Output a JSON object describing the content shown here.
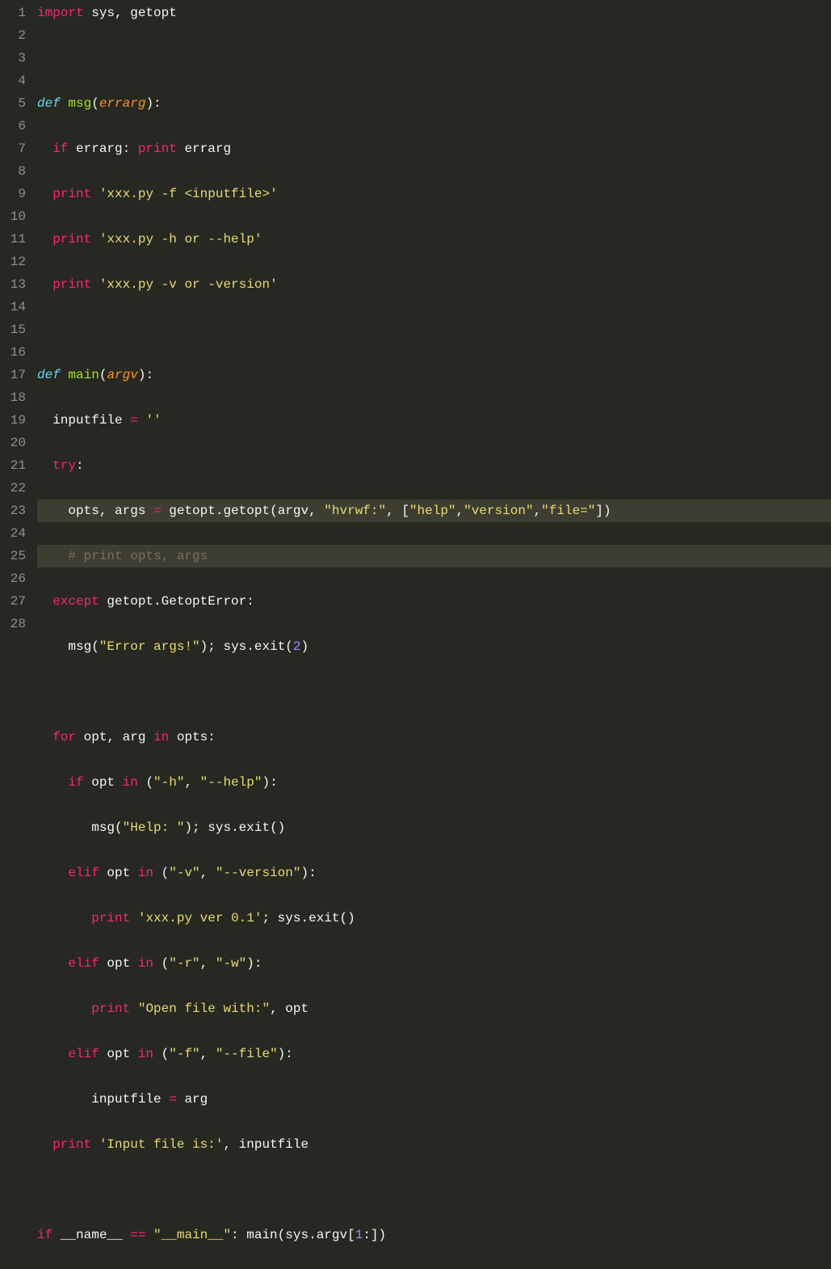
{
  "lines": [
    {
      "num": "1",
      "hl": false,
      "tokens": [
        {
          "cls": "kw-import",
          "t": "import"
        },
        {
          "cls": "ident",
          "t": " sys"
        },
        {
          "cls": "punct",
          "t": ", "
        },
        {
          "cls": "ident",
          "t": "getopt"
        }
      ]
    },
    {
      "num": "2",
      "hl": false,
      "tokens": []
    },
    {
      "num": "3",
      "hl": false,
      "tokens": [
        {
          "cls": "kw-def",
          "t": "def"
        },
        {
          "cls": "ident",
          "t": " "
        },
        {
          "cls": "fn-name",
          "t": "msg"
        },
        {
          "cls": "punct",
          "t": "("
        },
        {
          "cls": "param",
          "t": "errarg"
        },
        {
          "cls": "punct",
          "t": "):"
        }
      ]
    },
    {
      "num": "4",
      "hl": false,
      "tokens": [
        {
          "cls": "ident",
          "t": "  "
        },
        {
          "cls": "kw-pink",
          "t": "if"
        },
        {
          "cls": "ident",
          "t": " errarg"
        },
        {
          "cls": "punct",
          "t": ": "
        },
        {
          "cls": "kw-pink",
          "t": "print"
        },
        {
          "cls": "ident",
          "t": " errarg"
        }
      ]
    },
    {
      "num": "5",
      "hl": false,
      "tokens": [
        {
          "cls": "ident",
          "t": "  "
        },
        {
          "cls": "kw-pink",
          "t": "print"
        },
        {
          "cls": "ident",
          "t": " "
        },
        {
          "cls": "string",
          "t": "'xxx.py -f <inputfile>'"
        }
      ]
    },
    {
      "num": "6",
      "hl": false,
      "tokens": [
        {
          "cls": "ident",
          "t": "  "
        },
        {
          "cls": "kw-pink",
          "t": "print"
        },
        {
          "cls": "ident",
          "t": " "
        },
        {
          "cls": "string",
          "t": "'xxx.py -h or --help'"
        }
      ]
    },
    {
      "num": "7",
      "hl": false,
      "tokens": [
        {
          "cls": "ident",
          "t": "  "
        },
        {
          "cls": "kw-pink",
          "t": "print"
        },
        {
          "cls": "ident",
          "t": " "
        },
        {
          "cls": "string",
          "t": "'xxx.py -v or -version'"
        }
      ]
    },
    {
      "num": "8",
      "hl": false,
      "tokens": []
    },
    {
      "num": "9",
      "hl": false,
      "tokens": [
        {
          "cls": "kw-def",
          "t": "def"
        },
        {
          "cls": "ident",
          "t": " "
        },
        {
          "cls": "fn-name",
          "t": "main"
        },
        {
          "cls": "punct",
          "t": "("
        },
        {
          "cls": "param",
          "t": "argv"
        },
        {
          "cls": "punct",
          "t": "):"
        }
      ]
    },
    {
      "num": "10",
      "hl": false,
      "tokens": [
        {
          "cls": "ident",
          "t": "  inputfile "
        },
        {
          "cls": "kw-pink",
          "t": "="
        },
        {
          "cls": "ident",
          "t": " "
        },
        {
          "cls": "string",
          "t": "''"
        }
      ]
    },
    {
      "num": "11",
      "hl": false,
      "tokens": [
        {
          "cls": "ident",
          "t": "  "
        },
        {
          "cls": "kw-pink",
          "t": "try"
        },
        {
          "cls": "punct",
          "t": ":"
        }
      ]
    },
    {
      "num": "12",
      "hl": true,
      "tokens": [
        {
          "cls": "ident",
          "t": "    opts"
        },
        {
          "cls": "punct",
          "t": ", "
        },
        {
          "cls": "ident",
          "t": "args "
        },
        {
          "cls": "kw-pink",
          "t": "="
        },
        {
          "cls": "ident",
          "t": " getopt"
        },
        {
          "cls": "punct",
          "t": "."
        },
        {
          "cls": "ident",
          "t": "getopt"
        },
        {
          "cls": "punct",
          "t": "("
        },
        {
          "cls": "ident",
          "t": "argv"
        },
        {
          "cls": "punct",
          "t": ", "
        },
        {
          "cls": "string",
          "t": "\"hvrwf:\""
        },
        {
          "cls": "punct",
          "t": ", ["
        },
        {
          "cls": "string",
          "t": "\"help\""
        },
        {
          "cls": "punct",
          "t": ","
        },
        {
          "cls": "string",
          "t": "\"version\""
        },
        {
          "cls": "punct",
          "t": ","
        },
        {
          "cls": "string",
          "t": "\"file=\""
        },
        {
          "cls": "punct",
          "t": "])"
        }
      ]
    },
    {
      "num": "13",
      "hl": true,
      "tokens": [
        {
          "cls": "ident",
          "t": "    "
        },
        {
          "cls": "comment",
          "t": "# print opts, args"
        }
      ]
    },
    {
      "num": "14",
      "hl": false,
      "tokens": [
        {
          "cls": "ident",
          "t": "  "
        },
        {
          "cls": "kw-pink",
          "t": "except"
        },
        {
          "cls": "ident",
          "t": " getopt"
        },
        {
          "cls": "punct",
          "t": "."
        },
        {
          "cls": "ident",
          "t": "GetoptError"
        },
        {
          "cls": "punct",
          "t": ":"
        }
      ]
    },
    {
      "num": "15",
      "hl": false,
      "tokens": [
        {
          "cls": "ident",
          "t": "    msg"
        },
        {
          "cls": "punct",
          "t": "("
        },
        {
          "cls": "string",
          "t": "\"Error args!\""
        },
        {
          "cls": "punct",
          "t": "); "
        },
        {
          "cls": "ident",
          "t": "sys"
        },
        {
          "cls": "punct",
          "t": "."
        },
        {
          "cls": "ident",
          "t": "exit"
        },
        {
          "cls": "punct",
          "t": "("
        },
        {
          "cls": "number",
          "t": "2"
        },
        {
          "cls": "punct",
          "t": ")"
        }
      ]
    },
    {
      "num": "16",
      "hl": false,
      "tokens": []
    },
    {
      "num": "17",
      "hl": false,
      "tokens": [
        {
          "cls": "ident",
          "t": "  "
        },
        {
          "cls": "kw-pink",
          "t": "for"
        },
        {
          "cls": "ident",
          "t": " opt"
        },
        {
          "cls": "punct",
          "t": ", "
        },
        {
          "cls": "ident",
          "t": "arg "
        },
        {
          "cls": "kw-pink",
          "t": "in"
        },
        {
          "cls": "ident",
          "t": " opts"
        },
        {
          "cls": "punct",
          "t": ":"
        }
      ]
    },
    {
      "num": "18",
      "hl": false,
      "tokens": [
        {
          "cls": "ident",
          "t": "    "
        },
        {
          "cls": "kw-pink",
          "t": "if"
        },
        {
          "cls": "ident",
          "t": " opt "
        },
        {
          "cls": "kw-pink",
          "t": "in"
        },
        {
          "cls": "ident",
          "t": " "
        },
        {
          "cls": "punct",
          "t": "("
        },
        {
          "cls": "string",
          "t": "\"-h\""
        },
        {
          "cls": "punct",
          "t": ", "
        },
        {
          "cls": "string",
          "t": "\"--help\""
        },
        {
          "cls": "punct",
          "t": "):"
        }
      ]
    },
    {
      "num": "19",
      "hl": false,
      "tokens": [
        {
          "cls": "ident",
          "t": "       msg"
        },
        {
          "cls": "punct",
          "t": "("
        },
        {
          "cls": "string",
          "t": "\"Help: \""
        },
        {
          "cls": "punct",
          "t": "); "
        },
        {
          "cls": "ident",
          "t": "sys"
        },
        {
          "cls": "punct",
          "t": "."
        },
        {
          "cls": "ident",
          "t": "exit"
        },
        {
          "cls": "punct",
          "t": "()"
        }
      ]
    },
    {
      "num": "20",
      "hl": false,
      "tokens": [
        {
          "cls": "ident",
          "t": "    "
        },
        {
          "cls": "kw-pink",
          "t": "elif"
        },
        {
          "cls": "ident",
          "t": " opt "
        },
        {
          "cls": "kw-pink",
          "t": "in"
        },
        {
          "cls": "ident",
          "t": " "
        },
        {
          "cls": "punct",
          "t": "("
        },
        {
          "cls": "string",
          "t": "\"-v\""
        },
        {
          "cls": "punct",
          "t": ", "
        },
        {
          "cls": "string",
          "t": "\"--version\""
        },
        {
          "cls": "punct",
          "t": "):"
        }
      ]
    },
    {
      "num": "21",
      "hl": false,
      "tokens": [
        {
          "cls": "ident",
          "t": "       "
        },
        {
          "cls": "kw-pink",
          "t": "print"
        },
        {
          "cls": "ident",
          "t": " "
        },
        {
          "cls": "string",
          "t": "'xxx.py ver 0.1'"
        },
        {
          "cls": "punct",
          "t": "; "
        },
        {
          "cls": "ident",
          "t": "sys"
        },
        {
          "cls": "punct",
          "t": "."
        },
        {
          "cls": "ident",
          "t": "exit"
        },
        {
          "cls": "punct",
          "t": "()"
        }
      ]
    },
    {
      "num": "22",
      "hl": false,
      "tokens": [
        {
          "cls": "ident",
          "t": "    "
        },
        {
          "cls": "kw-pink",
          "t": "elif"
        },
        {
          "cls": "ident",
          "t": " opt "
        },
        {
          "cls": "kw-pink",
          "t": "in"
        },
        {
          "cls": "ident",
          "t": " "
        },
        {
          "cls": "punct",
          "t": "("
        },
        {
          "cls": "string",
          "t": "\"-r\""
        },
        {
          "cls": "punct",
          "t": ", "
        },
        {
          "cls": "string",
          "t": "\"-w\""
        },
        {
          "cls": "punct",
          "t": "):"
        }
      ]
    },
    {
      "num": "23",
      "hl": false,
      "tokens": [
        {
          "cls": "ident",
          "t": "       "
        },
        {
          "cls": "kw-pink",
          "t": "print"
        },
        {
          "cls": "ident",
          "t": " "
        },
        {
          "cls": "string",
          "t": "\"Open file with:\""
        },
        {
          "cls": "punct",
          "t": ", "
        },
        {
          "cls": "ident",
          "t": "opt"
        }
      ]
    },
    {
      "num": "24",
      "hl": false,
      "tokens": [
        {
          "cls": "ident",
          "t": "    "
        },
        {
          "cls": "kw-pink",
          "t": "elif"
        },
        {
          "cls": "ident",
          "t": " opt "
        },
        {
          "cls": "kw-pink",
          "t": "in"
        },
        {
          "cls": "ident",
          "t": " "
        },
        {
          "cls": "punct",
          "t": "("
        },
        {
          "cls": "string",
          "t": "\"-f\""
        },
        {
          "cls": "punct",
          "t": ", "
        },
        {
          "cls": "string",
          "t": "\"--file\""
        },
        {
          "cls": "punct",
          "t": "):"
        }
      ]
    },
    {
      "num": "25",
      "hl": false,
      "tokens": [
        {
          "cls": "ident",
          "t": "       inputfile "
        },
        {
          "cls": "kw-pink",
          "t": "="
        },
        {
          "cls": "ident",
          "t": " arg"
        }
      ]
    },
    {
      "num": "26",
      "hl": false,
      "tokens": [
        {
          "cls": "ident",
          "t": "  "
        },
        {
          "cls": "kw-pink",
          "t": "print"
        },
        {
          "cls": "ident",
          "t": " "
        },
        {
          "cls": "string",
          "t": "'Input file is:'"
        },
        {
          "cls": "punct",
          "t": ", "
        },
        {
          "cls": "ident",
          "t": "inputfile"
        }
      ]
    },
    {
      "num": "27",
      "hl": false,
      "tokens": []
    },
    {
      "num": "28",
      "hl": false,
      "tokens": [
        {
          "cls": "kw-pink",
          "t": "if"
        },
        {
          "cls": "ident",
          "t": " __name__ "
        },
        {
          "cls": "kw-pink",
          "t": "=="
        },
        {
          "cls": "ident",
          "t": " "
        },
        {
          "cls": "string",
          "t": "\"__main__\""
        },
        {
          "cls": "punct",
          "t": ": "
        },
        {
          "cls": "ident",
          "t": "main"
        },
        {
          "cls": "punct",
          "t": "("
        },
        {
          "cls": "ident",
          "t": "sys"
        },
        {
          "cls": "punct",
          "t": "."
        },
        {
          "cls": "ident",
          "t": "argv"
        },
        {
          "cls": "punct",
          "t": "["
        },
        {
          "cls": "number",
          "t": "1"
        },
        {
          "cls": "punct",
          "t": ":])"
        }
      ]
    }
  ]
}
